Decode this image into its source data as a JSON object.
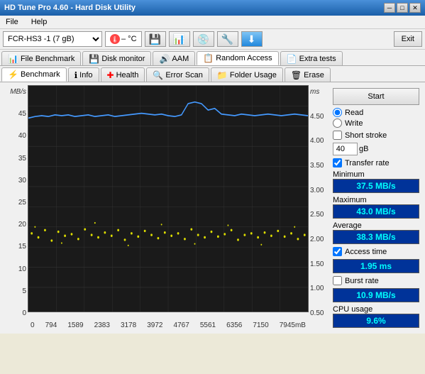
{
  "titleBar": {
    "title": "HD Tune Pro 4.60 - Hard Disk Utility",
    "minBtn": "─",
    "maxBtn": "□",
    "closeBtn": "✕"
  },
  "menu": {
    "file": "File",
    "help": "Help"
  },
  "toolbar": {
    "drive": "FCR-HS3    -1 (7 gB)",
    "temp": "– °C",
    "exitLabel": "Exit"
  },
  "tabs1": [
    {
      "id": "file-benchmark",
      "label": "File Benchmark",
      "icon": "📊"
    },
    {
      "id": "disk-monitor",
      "label": "Disk monitor",
      "icon": "💾"
    },
    {
      "id": "aam",
      "label": "AAM",
      "icon": "🔊"
    },
    {
      "id": "random-access",
      "label": "Random Access",
      "icon": "📋",
      "active": true
    },
    {
      "id": "extra-tests",
      "label": "Extra tests",
      "icon": "📄"
    }
  ],
  "tabs2": [
    {
      "id": "benchmark",
      "label": "Benchmark",
      "icon": "⚡"
    },
    {
      "id": "info",
      "label": "Info",
      "icon": "ℹ"
    },
    {
      "id": "health",
      "label": "Health",
      "icon": "➕"
    },
    {
      "id": "error-scan",
      "label": "Error Scan",
      "icon": "🔍"
    },
    {
      "id": "folder-usage",
      "label": "Folder Usage",
      "icon": "📁"
    },
    {
      "id": "erase",
      "label": "Erase",
      "icon": "🗑"
    }
  ],
  "chart": {
    "yLeftLabel": "MB/s",
    "yRightLabel": "ms",
    "yLeftValues": [
      "45",
      "40",
      "35",
      "30",
      "25",
      "20",
      "15",
      "10",
      "5",
      "0"
    ],
    "yRightValues": [
      "4.50",
      "4.00",
      "3.50",
      "3.00",
      "2.50",
      "2.00",
      "1.50",
      "1.00",
      "0.50"
    ],
    "xValues": [
      "0",
      "794",
      "1589",
      "2383",
      "3178",
      "3972",
      "4767",
      "5561",
      "6356",
      "7150",
      "7945mB"
    ]
  },
  "panel": {
    "startLabel": "Start",
    "readLabel": "Read",
    "writeLabel": "Write",
    "shortStrokeLabel": "Short stroke",
    "gBLabel": "gB",
    "transferRateLabel": "Transfer rate",
    "minimumLabel": "Minimum",
    "minimumValue": "37.5 MB/s",
    "maximumLabel": "Maximum",
    "maximumValue": "43.0 MB/s",
    "averageLabel": "Average",
    "averageValue": "38.3 MB/s",
    "accessTimeLabel": "Access time",
    "accessTimeValue": "1.95 ms",
    "burstRateLabel": "Burst rate",
    "burstRateValue": "10.9 MB/s",
    "cpuUsageLabel": "CPU usage",
    "cpuUsageValue": "9.6%",
    "spinboxValue": "40"
  }
}
